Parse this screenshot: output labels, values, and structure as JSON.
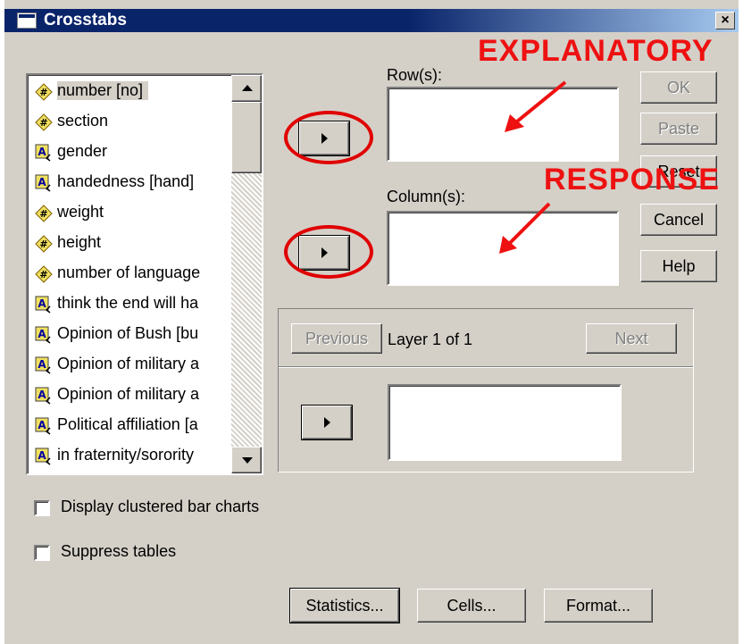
{
  "dialog": {
    "title": "Crosstabs",
    "close_glyph": "×"
  },
  "variables": [
    {
      "label": "number [no]",
      "icon": "scale-icon",
      "selected": true
    },
    {
      "label": "section",
      "icon": "scale-icon"
    },
    {
      "label": "gender",
      "icon": "string-icon"
    },
    {
      "label": "handedness [hand]",
      "icon": "string-icon"
    },
    {
      "label": "weight",
      "icon": "scale-icon"
    },
    {
      "label": "height",
      "icon": "scale-icon"
    },
    {
      "label": "number of language",
      "icon": "scale-icon"
    },
    {
      "label": "think the end will ha",
      "icon": "string-icon"
    },
    {
      "label": "Opinion of Bush [bu",
      "icon": "string-icon"
    },
    {
      "label": "Opinion of military a",
      "icon": "string-icon"
    },
    {
      "label": "Opinion of military a",
      "icon": "string-icon"
    },
    {
      "label": "Political affiliation [a",
      "icon": "string-icon"
    },
    {
      "label": "in fraternity/sorority",
      "icon": "string-icon"
    }
  ],
  "rows_label": "Row(s):",
  "columns_label": "Column(s):",
  "buttons": {
    "ok": "OK",
    "paste": "Paste",
    "reset": "Reset",
    "cancel": "Cancel",
    "help": "Help"
  },
  "layer": {
    "previous": "Previous",
    "label": "Layer 1 of 1",
    "next": "Next"
  },
  "checkboxes": {
    "clustered": "Display clustered bar charts",
    "suppress": "Suppress tables"
  },
  "bottom_buttons": {
    "statistics": "Statistics...",
    "cells": "Cells...",
    "format": "Format..."
  },
  "annotations": {
    "explanatory": "EXPLANATORY",
    "response": "RESPONSE"
  },
  "colors": {
    "title_bar": "#0a246a",
    "annotation": "#ee1111",
    "dialog_bg": "#d4d0c8"
  }
}
